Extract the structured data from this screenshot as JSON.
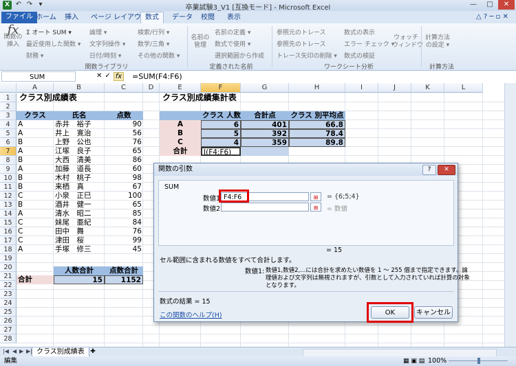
{
  "window": {
    "title": "卒業試験3_V1 [互換モード] - Microsoft Excel",
    "quick_access": [
      "↶",
      "↷",
      "▾"
    ]
  },
  "ribbon": {
    "tabs": [
      "ファイル",
      "ホーム",
      "挿入",
      "ページ レイアウト",
      "数式",
      "データ",
      "校閲",
      "表示"
    ],
    "active_tab": "数式",
    "items": {
      "insert_function": "関数の\n挿入",
      "autosum": "Σ オート SUM ▾",
      "recent": "最近使用した関数 ▾",
      "financial": "財務 ▾",
      "logical": "論理 ▾",
      "text": "文字列操作 ▾",
      "datetime": "日付/時刻 ▾",
      "lookup": "検索/行列 ▾",
      "math": "数学/三角 ▾",
      "more": "その他の関数 ▾",
      "name_manager": "名前の\n管理",
      "define_name": "名前の定義 ▾",
      "use_in_formula": "数式で使用 ▾",
      "create_from_selection": "選択範囲から作成",
      "trace_precedents": "参照元のトレース",
      "trace_dependents": "参照先のトレース",
      "remove_arrows": "トレース矢印の削除 ▾",
      "show_formulas": "数式の表示",
      "error_check": "エラー チェック ▾",
      "evaluate": "数式の検証",
      "watch": "ウォッチ\nウィンドウ",
      "calc_options": "計算方法\nの設定 ▾"
    },
    "groups": {
      "function_library": "関数ライブラリ",
      "defined_names": "定義された名前",
      "formula_auditing": "ワークシート分析",
      "calculation": "計算方法"
    }
  },
  "formula_bar": {
    "name_box": "SUM",
    "cancel": "✕",
    "enter": "✓",
    "fx": "fx",
    "formula": "=SUM(F4:F6)"
  },
  "grid": {
    "columns": [
      "A",
      "B",
      "C",
      "D",
      "E",
      "F",
      "G",
      "H",
      "I",
      "J",
      "K",
      "L"
    ],
    "rows": [
      "1",
      "2",
      "3",
      "4",
      "5",
      "6",
      "7",
      "8",
      "9",
      "10",
      "11",
      "12",
      "13",
      "14",
      "15",
      "16",
      "17",
      "18",
      "19",
      "20",
      "21",
      "22",
      "23",
      "24",
      "25",
      "26",
      "27",
      "28"
    ],
    "left_table": {
      "title": "クラス別成績表",
      "headers": [
        "クラス",
        "氏名",
        "点数"
      ],
      "rows": [
        [
          "A",
          "赤井　裕子",
          "90"
        ],
        [
          "A",
          "井上　寛治",
          "56"
        ],
        [
          "B",
          "上野　公也",
          "76"
        ],
        [
          "A",
          "江塚　良子",
          "65"
        ],
        [
          "B",
          "大西　清美",
          "86"
        ],
        [
          "A",
          "加藤　道長",
          "60"
        ],
        [
          "B",
          "木村　桃子",
          "98"
        ],
        [
          "B",
          "来栖　真",
          "67"
        ],
        [
          "C",
          "小泉　正巳",
          "100"
        ],
        [
          "B",
          "酒井　健一",
          "65"
        ],
        [
          "A",
          "清水　昭二",
          "85"
        ],
        [
          "C",
          "妹尾　亜紀",
          "84"
        ],
        [
          "C",
          "田中　舞",
          "76"
        ],
        [
          "C",
          "津田　桜",
          "99"
        ],
        [
          "A",
          "手塚　修三",
          "45"
        ]
      ],
      "summary_headers": [
        "人数合計",
        "点数合計"
      ],
      "total_label": "合計",
      "summary_values": [
        "15",
        "1152"
      ]
    },
    "right_table": {
      "title": "クラス別成績集計表",
      "headers": [
        "クラス 人数",
        "合計点",
        "クラス 別平均点"
      ],
      "rows": [
        [
          "A",
          "6",
          "401",
          "66.8"
        ],
        [
          "B",
          "5",
          "392",
          "78.4"
        ],
        [
          "C",
          "4",
          "359",
          "89.8"
        ]
      ],
      "total_label": "合計",
      "editing_cell": "I(F4:F6)"
    }
  },
  "dialog": {
    "title": "関数の引数",
    "help_btn": "?",
    "close_btn": "✕",
    "function_name": "SUM",
    "arg1_label": "数値1",
    "arg1_value": "F4:F6",
    "arg1_result": "=  {6;5;4}",
    "arg2_label": "数値2",
    "arg2_value": "",
    "arg2_result": "=  数値",
    "result_line": "=  15",
    "description": "セル範囲に含まれる数値をすべて合計します。",
    "arg_desc_label": "数値1:",
    "arg_desc_line1": "数値1,数値2,...には合計を求めたい数値を 1 〜 255 個まで指定できます。論",
    "arg_desc_line2": "理値および文字列は無視されますが、引数として入力されていれば計算の対象",
    "arg_desc_line3": "となります。",
    "formula_result": "数式の結果 =  15",
    "help_link": "この関数のヘルプ(H)",
    "ok": "OK",
    "cancel": "キャンセル",
    "ref_icon": "⊞"
  },
  "sheet_tabs": {
    "nav": [
      "|◀",
      "◀",
      "▶",
      "▶|"
    ],
    "active": "クラス別成績表"
  },
  "status": {
    "mode": "編集",
    "zoom": "100%"
  },
  "colors": {
    "header_blue": "#c6d6ec",
    "header_blue_dark": "#9dbde3",
    "pink": "#f2dcdb",
    "highlight_red": "#e00000"
  }
}
